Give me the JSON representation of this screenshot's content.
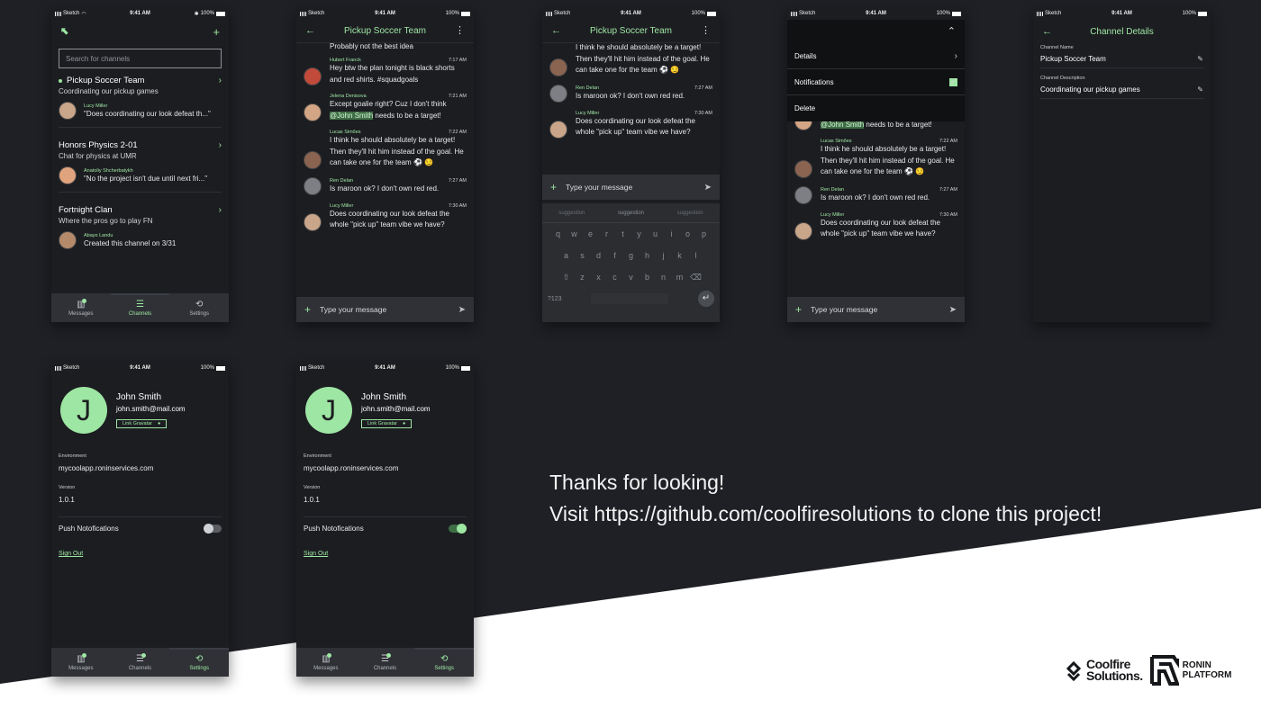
{
  "status_bar": {
    "carrier": "Sketch",
    "time": "9:41 AM",
    "battery": "100%"
  },
  "colors": {
    "accent": "#9ee6a3",
    "screen_bg": "#1c1d21",
    "page_bg": "#1e2025",
    "bar_bg": "#2f3136"
  },
  "channels_screen": {
    "search_placeholder": "Search for channels",
    "channels": [
      {
        "name": "Pickup Soccer Team",
        "description": "Coordinating our pickup games",
        "last_author": "Lucy Miller",
        "last_message": "\"Does coordinating our look defeat th...\"",
        "unread": true
      },
      {
        "name": "Honors Physics 2-01",
        "description": "Chat for physics at UMR",
        "last_author": "Anatoliy Shcherbatykh",
        "last_message": "\"No the project isn't due until next fri...\"",
        "unread": false
      },
      {
        "name": "Fortnight Clan",
        "description": "Where the pros go to play FN",
        "last_author": "Abayo Landu",
        "last_message": "Created this channel on 3/31",
        "unread": false
      }
    ]
  },
  "tabs": {
    "messages": "Messages",
    "channels": "Channels",
    "settings": "Settings"
  },
  "chat": {
    "title": "Pickup Soccer Team",
    "input_placeholder": "Type your message",
    "top_fragment": "Probably not the best idea",
    "messages": [
      {
        "author": "Hubert Franck",
        "time": "7:17 AM",
        "text": "Hey btw the plan tonight is black shorts and red shirts. #squadgoals"
      },
      {
        "author": "Jelena Denisova",
        "time": "7:21 AM",
        "text_before": "Except goalie right?  Cuz I don't think ",
        "mention": "@John Smith",
        "text_after": " needs to be a target!"
      },
      {
        "author": "Lucas Simões",
        "time": "7:22 AM",
        "text": "I think he should absolutely be a target!  Then they'll hit him instead of the goal.  He can take one for the team ⚽ 😏"
      },
      {
        "author": "Ren Delan",
        "time": "7:27 AM",
        "text": "Is maroon ok?  I don't own red red."
      },
      {
        "author": "Lucy Miller",
        "time": "7:30 AM",
        "text": "Does coordinating our look defeat the whole \"pick up\" team vibe we have?"
      }
    ]
  },
  "keyboard": {
    "suggestions": [
      "suggestion",
      "suggestion",
      "suggestion"
    ],
    "row1": [
      "q",
      "w",
      "e",
      "r",
      "t",
      "y",
      "u",
      "i",
      "o",
      "p"
    ],
    "row2": [
      "a",
      "s",
      "d",
      "f",
      "g",
      "h",
      "j",
      "k",
      "l"
    ],
    "row3": [
      "z",
      "x",
      "c",
      "v",
      "b",
      "n",
      "m"
    ],
    "numbers_key": "?123"
  },
  "channel_menu": {
    "details": "Details",
    "notifications": "Notifications",
    "delete": "Delete"
  },
  "channel_details": {
    "title": "Channel Details",
    "name_label": "Channel Name",
    "name_value": "Pickup Soccer Team",
    "desc_label": "Channel Description",
    "desc_value": "Coordinating our pickup games"
  },
  "profile": {
    "initial": "J",
    "name": "John Smith",
    "email": "john.smith@mail.com",
    "link_gravatar": "Link Gravatar",
    "environment_label": "Environment",
    "environment_value": "mycoolapp.roninservices.com",
    "version_label": "Version",
    "version_value": "1.0.1",
    "push_label": "Push Notofications",
    "push_off": false,
    "push_on": true,
    "sign_out": "Sign Out"
  },
  "thanks": {
    "line1": "Thanks for looking!",
    "line2": "Visit https://github.com/coolfiresolutions to clone this project!"
  },
  "logos": {
    "coolfire_line1": "Coolfire",
    "coolfire_line2": "Solutions.",
    "ronin_line1": "RONIN",
    "ronin_line2": "PLATFORM"
  }
}
